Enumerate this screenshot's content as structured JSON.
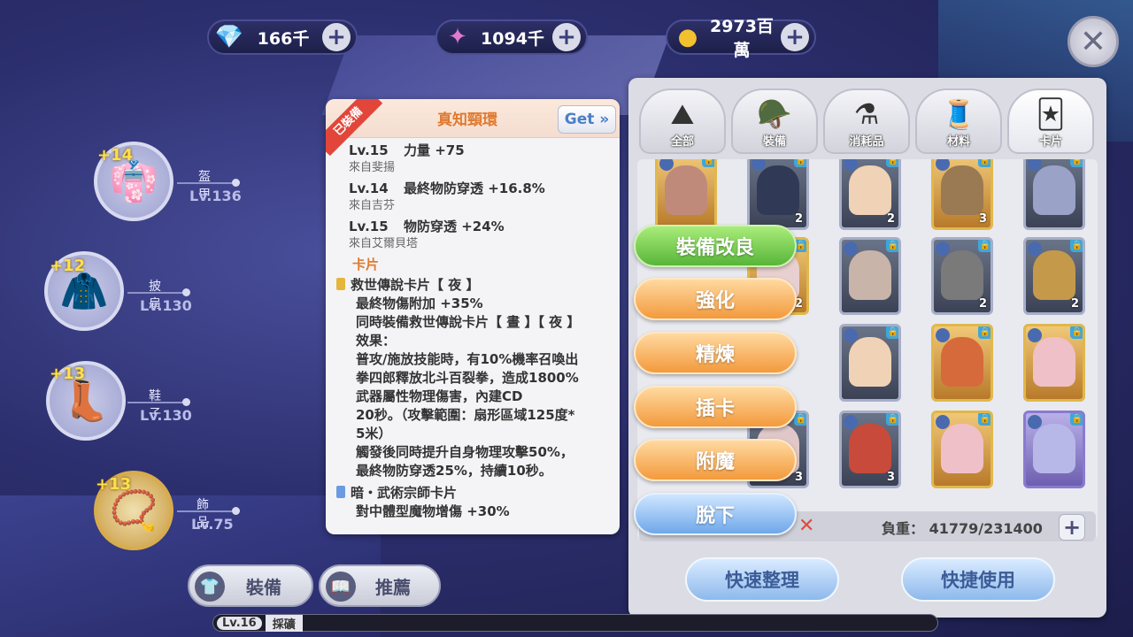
{
  "currencies": [
    {
      "icon": "diamond-icon",
      "value": "166千"
    },
    {
      "icon": "crystal-icon",
      "value": "1094千"
    },
    {
      "icon": "gold-coin-icon",
      "value": "2973百萬"
    }
  ],
  "equipment_slots": [
    {
      "plus": "+14",
      "name": "盔甲",
      "level": "Lv.136"
    },
    {
      "plus": "+12",
      "name": "披肩",
      "level": "Lv.130"
    },
    {
      "plus": "+13",
      "name": "鞋子",
      "level": "Lv.130"
    },
    {
      "plus": "+13",
      "name": "飾品",
      "level": "Lv.75"
    }
  ],
  "tooltip": {
    "ribbon": "已裝備",
    "title": "真知頸環",
    "get_label": "Get »",
    "stats": [
      {
        "lv": "Lv.15",
        "stat": "力量 +75",
        "source": "來自斐揚"
      },
      {
        "lv": "Lv.14",
        "stat": "最終物防穿透 +16.8%",
        "source": "來自吉芬"
      },
      {
        "lv": "Lv.15",
        "stat": "物防穿透 +24%",
        "source": "來自艾爾貝塔"
      }
    ],
    "card_section": "卡片",
    "card1": {
      "name": "救世傳說卡片【 夜 】",
      "lines": [
        "最終物傷附加 +35%",
        "同時裝備救世傳說卡片【 晝 】【 夜 】",
        "效果：",
        "普攻/施放技能時，有10%機率召喚出",
        "拳四郎釋放北斗百裂拳，造成1800%",
        "武器屬性物理傷害，內建CD",
        "20秒。（攻擊範圍：扇形區域125度*",
        "5米）",
        "觸發後同時提升自身物理攻擊50%，",
        "最終物防穿透25%，持續10秒。"
      ]
    },
    "card2": {
      "name": "暗・武術宗師卡片",
      "lines": [
        "對中體型魔物增傷 +30%"
      ]
    }
  },
  "actions": [
    "裝備改良",
    "強化",
    "精煉",
    "插卡",
    "附魔",
    "脫下"
  ],
  "inventory": {
    "tabs": [
      {
        "label": "全部",
        "icon": "all-icon"
      },
      {
        "label": "裝備",
        "icon": "equipment-icon"
      },
      {
        "label": "消耗品",
        "icon": "potion-icon"
      },
      {
        "label": "材料",
        "icon": "material-icon"
      },
      {
        "label": "卡片",
        "icon": "card-icon"
      }
    ],
    "cards": [
      {
        "style": "gold",
        "count": ""
      },
      {
        "style": "",
        "count": "2"
      },
      {
        "style": "",
        "count": "2"
      },
      {
        "style": "gold",
        "count": "3"
      },
      {
        "style": "",
        "count": ""
      },
      {
        "style": "",
        "count": ""
      },
      {
        "style": "",
        "count": "2"
      },
      {
        "style": "",
        "count": "2"
      },
      {
        "style": "gold",
        "count": "2"
      },
      {
        "style": "",
        "count": ""
      },
      {
        "style": "",
        "count": ""
      },
      {
        "style": "gold",
        "count": ""
      },
      {
        "style": "gold",
        "count": ""
      },
      {
        "style": "",
        "count": "3"
      },
      {
        "style": "",
        "count": "3"
      },
      {
        "style": "gold",
        "count": ""
      },
      {
        "style": "purple",
        "count": ""
      }
    ],
    "weight_label": "負重： 41779/231400",
    "buttons": [
      "快速整理",
      "快捷使用"
    ]
  },
  "bottom_tabs": [
    "裝備",
    "推薦"
  ],
  "level_strip": {
    "level": "Lv.16",
    "name": "採礦"
  }
}
